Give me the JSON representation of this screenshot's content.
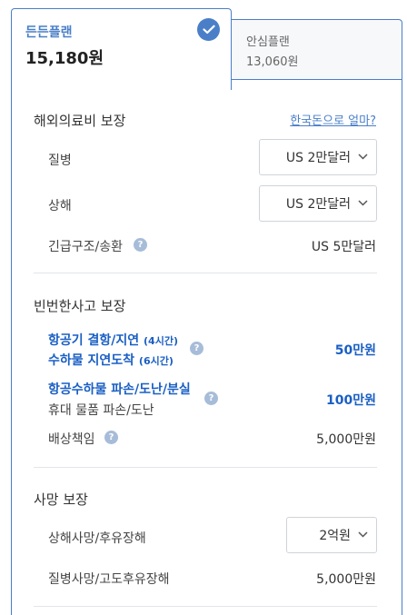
{
  "plans": {
    "selected": {
      "name": "든든플랜",
      "price": "15,180원"
    },
    "other": {
      "name": "안심플랜",
      "price": "13,060원"
    }
  },
  "overseas_medical": {
    "title": "해외의료비 보장",
    "currency_link": "한국돈으로 얼마?",
    "illness": {
      "label": "질병",
      "value": "US 2만달러"
    },
    "injury": {
      "label": "상해",
      "value": "US 2만달러"
    },
    "rescue": {
      "label": "긴급구조/송환",
      "value": "US 5만달러"
    }
  },
  "frequent_accidents": {
    "title": "빈번한사고 보장",
    "flight_delay": {
      "line1": "항공기 결항/지연",
      "line1_note": "(4시간)",
      "line2": "수하물 지연도착",
      "line2_note": "(6시간)",
      "value": "50만원"
    },
    "baggage_loss": {
      "line1": "항공수하물 파손/도난/분실",
      "line2": "휴대 물품 파손/도난",
      "value": "100만원"
    },
    "liability": {
      "label": "배상책임",
      "value": "5,000만원"
    }
  },
  "death": {
    "title": "사망 보장",
    "injury_death": {
      "label": "상해사망/후유장해",
      "value": "2억원"
    },
    "illness_death": {
      "label": "질병사망/고도후유장해",
      "value": "5,000만원"
    }
  },
  "icons": {
    "check": "check-icon",
    "help": "help-icon",
    "dropdown": "chevron-down-icon"
  },
  "colors": {
    "accent": "#4a7fc8",
    "emphasis": "#1a5fc4",
    "help_icon": "#a7bcd8"
  }
}
